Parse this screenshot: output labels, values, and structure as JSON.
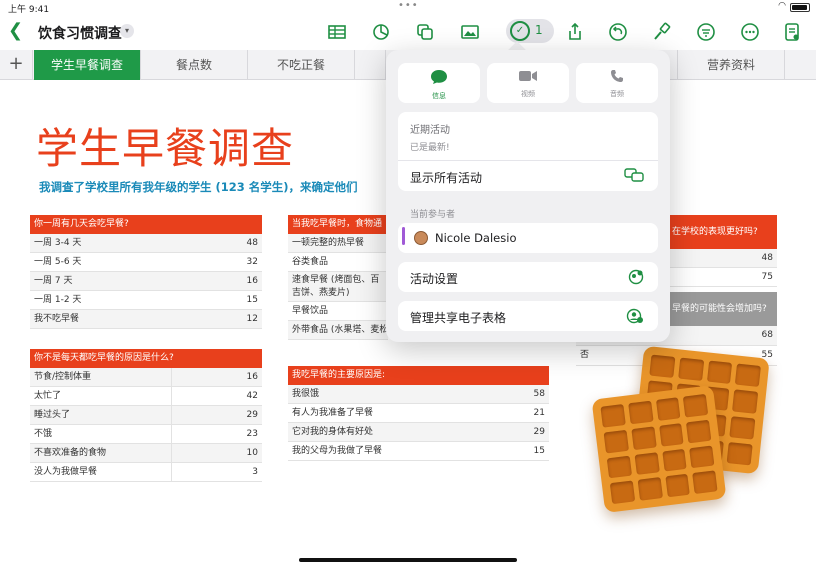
{
  "status": {
    "time": "上午 9:41",
    "dots": "•••",
    "wifi": "wifi-icon"
  },
  "toolbar": {
    "title": "饮食习惯调查",
    "collab_count": "1",
    "accent": "#1f8f43"
  },
  "tabs": [
    "学生早餐调查",
    "餐点数",
    "不吃正餐",
    "",
    "",
    "营养资料"
  ],
  "sheet": {
    "title": "学生早餐调查",
    "subtitle": "我调查了学校里所有我年级的学生 (123 名学生)，来确定他们"
  },
  "table1": {
    "header": "你一周有几天会吃早餐?",
    "rows": [
      {
        "label": "一周 3-4 天",
        "value": "48"
      },
      {
        "label": "一周 5-6 天",
        "value": "32"
      },
      {
        "label": "一周 7 天",
        "value": "16"
      },
      {
        "label": "一周 1-2 天",
        "value": "15"
      },
      {
        "label": "我不吃早餐",
        "value": "12"
      }
    ]
  },
  "table2": {
    "header": "你不是每天都吃早餐的原因是什么?",
    "rows": [
      {
        "label": "节食/控制体重",
        "value": "16"
      },
      {
        "label": "太忙了",
        "value": "42"
      },
      {
        "label": "睡过头了",
        "value": "29"
      },
      {
        "label": "不饿",
        "value": "23"
      },
      {
        "label": "不喜欢准备的食物",
        "value": "10"
      },
      {
        "label": "没人为我做早餐",
        "value": "3"
      }
    ]
  },
  "table3": {
    "header": "当我吃早餐时，食物通",
    "rows": [
      {
        "label": "一顿完整的热早餐"
      },
      {
        "label": "谷类食品"
      },
      {
        "label": "速食早餐 (烤面包、百吉饼、燕麦片)"
      },
      {
        "label": "早餐饮品"
      },
      {
        "label": "外带食品 (水果塔、麦松"
      }
    ]
  },
  "table4": {
    "header": "我吃早餐的主要原因是:",
    "rows": [
      {
        "label": "我很饿",
        "value": "58"
      },
      {
        "label": "有人为我准备了早餐",
        "value": "21"
      },
      {
        "label": "它对我的身体有好处",
        "value": "29"
      },
      {
        "label": "我的父母为我做了早餐",
        "value": "15"
      }
    ]
  },
  "table5": {
    "header": "在学校的表现更好吗?",
    "values": [
      "48",
      "75"
    ]
  },
  "table6": {
    "header": "早餐的可能性会增加吗?",
    "rows": [
      {
        "label": "",
        "value": "68"
      },
      {
        "label": "否",
        "value": "55"
      }
    ]
  },
  "popover": {
    "buttons": [
      {
        "label": "信息",
        "icon": "message-icon"
      },
      {
        "label": "视频",
        "icon": "video-icon"
      },
      {
        "label": "音频",
        "icon": "phone-icon"
      }
    ],
    "recent_title": "近期活动",
    "recent_status": "已是最新!",
    "show_all": "显示所有活动",
    "participants_label": "当前参与者",
    "participant_name": "Nicole Dalesio",
    "activity_settings": "活动设置",
    "manage_sharing": "管理共享电子表格"
  }
}
